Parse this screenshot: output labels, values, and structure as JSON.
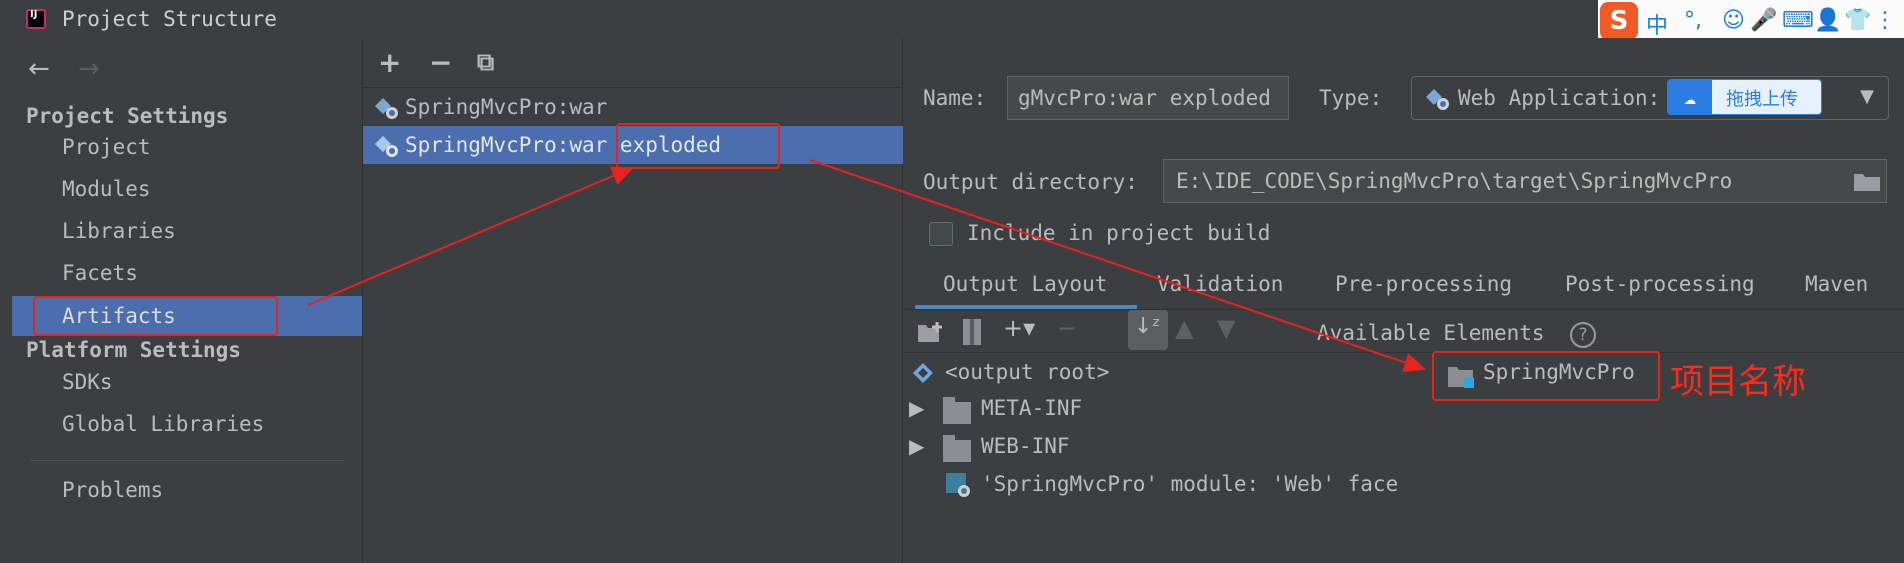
{
  "window": {
    "title": "Project Structure"
  },
  "ime_bar": {
    "items": [
      "中",
      "°,",
      "☺",
      "🎤",
      "⌨",
      "👤",
      "👕",
      "⋮⋮"
    ]
  },
  "left": {
    "back_arrow": "←",
    "forward_arrow": "→",
    "project_settings_title": "Project Settings",
    "project_items": [
      "Project",
      "Modules",
      "Libraries",
      "Facets",
      "Artifacts"
    ],
    "selected_item": "Artifacts",
    "platform_settings_title": "Platform Settings",
    "platform_items": [
      "SDKs",
      "Global Libraries"
    ],
    "problems": "Problems"
  },
  "middle": {
    "toolbar": {
      "add": "+",
      "remove": "−",
      "copy": "⧉"
    },
    "artifacts": [
      "SpringMvcPro:war",
      "SpringMvcPro:war exploded"
    ],
    "selected_artifact": "SpringMvcPro:war exploded"
  },
  "right": {
    "name_label": "Name:",
    "name_value": "gMvcPro:war exploded",
    "type_label": "Type:",
    "type_value": "Web Application:",
    "baidu_overlay_text": "拖拽上传",
    "output_dir_label": "Output directory:",
    "output_dir_value": "E:\\IDE_CODE\\SpringMvcPro\\target\\SpringMvcPro",
    "include_in_build": "Include in project build",
    "include_checked": false,
    "tabs": [
      "Output Layout",
      "Validation",
      "Pre-processing",
      "Post-processing",
      "Maven"
    ],
    "active_tab": "Output Layout",
    "available_elements": "Available Elements",
    "help": "?",
    "tree": {
      "root": "<output root>",
      "children": [
        "META-INF",
        "WEB-INF",
        "'SpringMvcPro' module: 'Web' face"
      ]
    },
    "available_item": "SpringMvcPro"
  },
  "annotation": {
    "label": "项目名称",
    "color": "#e8221c"
  }
}
